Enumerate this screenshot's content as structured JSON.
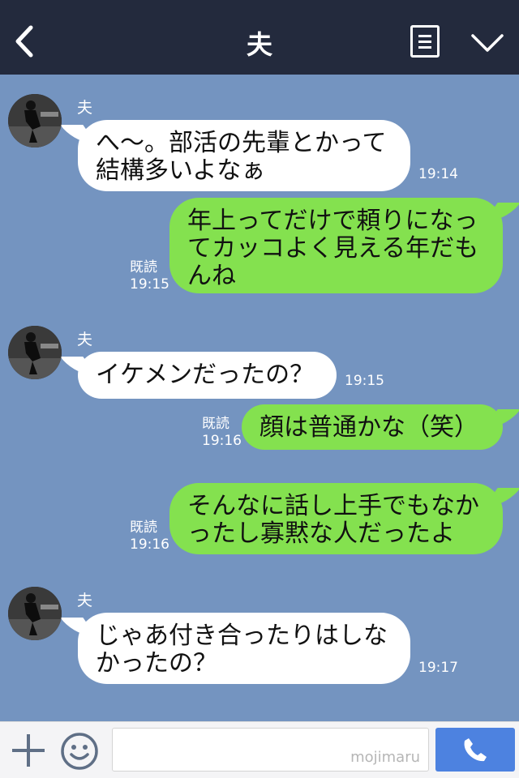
{
  "header": {
    "title": "夫",
    "back_icon": "chevron-left-icon",
    "menu_icon": "menu-list-icon",
    "collapse_icon": "chevron-down-icon"
  },
  "messages": [
    {
      "side": "in",
      "sender": "夫",
      "lines": [
        "へ〜。部活の先輩とかって",
        "結構多いよなぁ"
      ],
      "time": "19:14"
    },
    {
      "side": "out",
      "read": "既読",
      "lines": [
        "年上ってだけで頼りになっ",
        "てカッコよく見える年だも",
        "んね"
      ],
      "time": "19:15"
    },
    {
      "side": "in",
      "sender": "夫",
      "lines": [
        "イケメンだったの？"
      ],
      "time": "19:15"
    },
    {
      "side": "out",
      "read": "既読",
      "lines": [
        "顔は普通かな（笑）"
      ],
      "time": "19:16"
    },
    {
      "side": "out",
      "read": "既読",
      "lines": [
        "そんなに話し上手でもなか",
        "ったし寡黙な人だったよ"
      ],
      "time": "19:16"
    },
    {
      "side": "in",
      "sender": "夫",
      "lines": [
        "じゃあ付き合ったりはしな",
        "かったの？"
      ],
      "time": "19:17"
    }
  ],
  "footer": {
    "watermark": "mojimaru",
    "plus_icon": "plus-icon",
    "emoji_icon": "smiley-icon",
    "call_icon": "phone-icon"
  },
  "colors": {
    "background": "#7494c0",
    "header": "#232a3d",
    "incoming_bubble": "#ffffff",
    "outgoing_bubble": "#84e14f",
    "call_button": "#4d82e0"
  }
}
